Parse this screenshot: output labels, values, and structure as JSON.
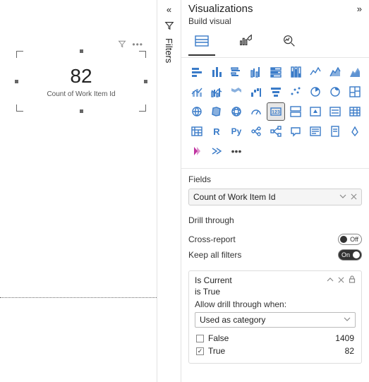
{
  "panel_title": "Visualizations",
  "build_label": "Build visual",
  "filters_rail_label": "Filters",
  "card": {
    "value": "82",
    "label": "Count of Work Item Id"
  },
  "fields": {
    "section": "Fields",
    "well_value": "Count of Work Item Id"
  },
  "drill": {
    "section": "Drill through",
    "cross_report_label": "Cross-report",
    "cross_report_state": "Off",
    "keep_filters_label": "Keep all filters",
    "keep_filters_state": "On",
    "field_name": "Is Current",
    "field_condition": "is True",
    "allow_label": "Allow drill through when:",
    "select_value": "Used as category",
    "values": [
      {
        "label": "False",
        "count": "1409",
        "checked": false
      },
      {
        "label": "True",
        "count": "82",
        "checked": true
      }
    ]
  },
  "gallery": [
    "stacked-bar",
    "stacked-col",
    "clustered-bar",
    "clustered-col",
    "stacked-bar-100",
    "stacked-col-100",
    "line",
    "area",
    "stacked-area",
    "line-stacked-col",
    "line-clustered-col",
    "ribbon",
    "waterfall",
    "funnel",
    "scatter",
    "pie",
    "donut",
    "treemap",
    "map",
    "filled-map",
    "globe",
    "gauge",
    "card",
    "multi-row",
    "kpi",
    "slicer",
    "table",
    "matrix",
    "r-visual",
    "py-visual",
    "key-influencers",
    "decomp-tree",
    "qna",
    "narrative",
    "paginated",
    "arcgis",
    "powerapps",
    "powerautomate",
    "more-visuals"
  ],
  "selected_gallery_index": 22
}
